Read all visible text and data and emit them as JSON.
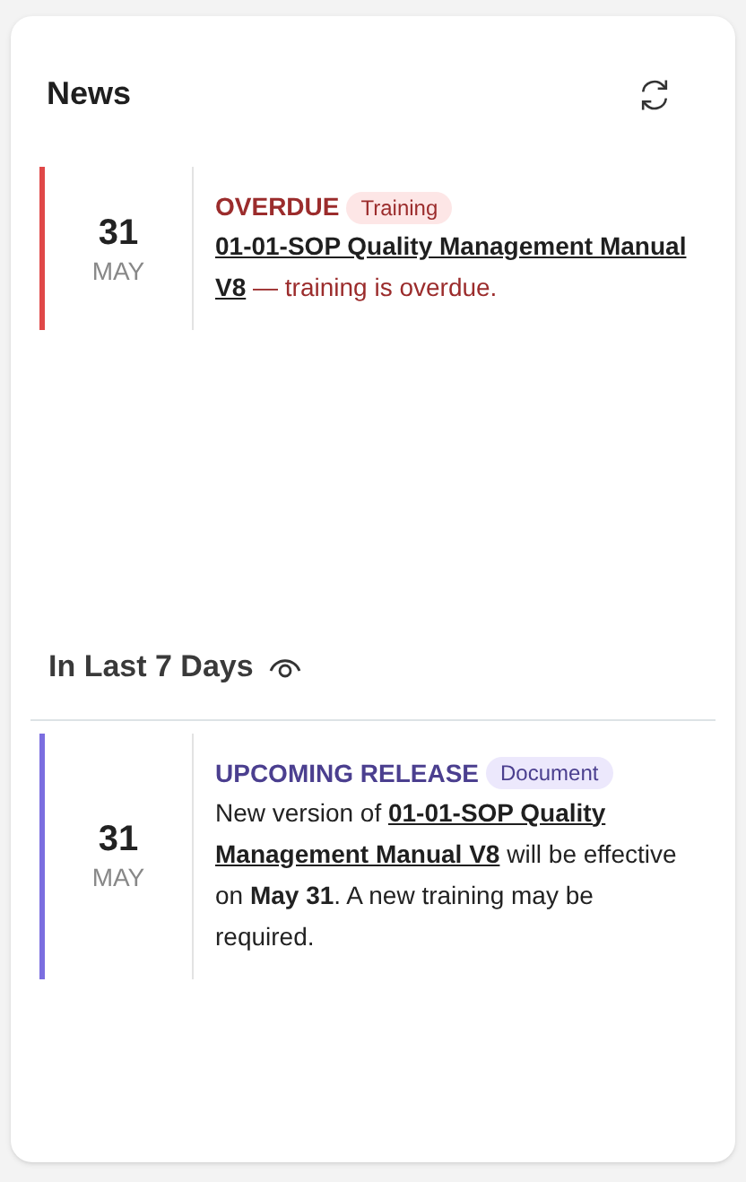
{
  "header": {
    "title": "News"
  },
  "news": [
    {
      "kind": "overdue",
      "day": "31",
      "month": "MAY",
      "status": "OVERDUE",
      "tag": "Training",
      "lines": [
        [
          {
            "text": "01-01-SOP Quality Management Manual",
            "link": true
          }
        ],
        [
          {
            "text": "V8",
            "link": true
          },
          {
            "text": " — training is overdue.",
            "link": false
          }
        ]
      ]
    }
  ],
  "recent": {
    "title": "In Last 7 Days",
    "items": [
      {
        "kind": "upcoming",
        "day": "31",
        "month": "MAY",
        "status": "UPCOMING RELEASE",
        "tag": "Document",
        "lines": [
          [
            {
              "text": "New version of ",
              "link": false
            },
            {
              "text": "01-01-SOP Quality",
              "link": true
            }
          ],
          [
            {
              "text": "Management Manual V8",
              "link": true
            },
            {
              "text": " will be effective",
              "link": false
            }
          ],
          [
            {
              "text": "on **May 31**. A new training may be",
              "link": false
            }
          ],
          [
            {
              "text": "required.",
              "link": false
            }
          ]
        ]
      }
    ]
  }
}
